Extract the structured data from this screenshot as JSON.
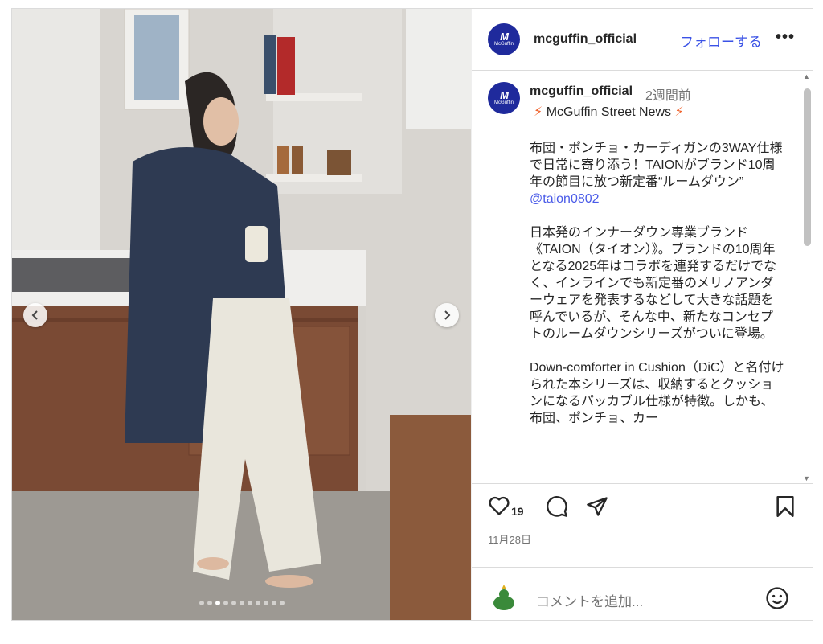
{
  "header": {
    "username": "mcguffin_official",
    "follow_label": "フォローする",
    "more_label": "•••"
  },
  "avatar": {
    "mark": "M",
    "word": "McGuffin"
  },
  "post": {
    "username": "mcguffin_official",
    "time_ago": "2週間前",
    "news_label": "McGuffin Street News",
    "caption_p1": "布団・ポンチョ・カーディガンの3WAY仕様で日常に寄り添う！TAIONがブランド10周年の節目に放つ新定番“ルームダウン”",
    "mention": "@taion0802",
    "caption_p2": "日本発のインナーダウン専業ブランド《TAION（タイオン）》。ブランドの10周年となる2025年はコラボを連発するだけでなく、インラインでも新定番のメリノアンダーウェアを発表するなどして大きな話題を呼んでいるが、そんな中、新たなコンセプトのルームダウンシリーズがついに登場。",
    "caption_p3": "Down-comforter in Cushion（DiC）と名付けられた本シリーズは、収納するとクッションになるパッカブル仕様が特徴。しかも、布団、ポンチョ、カー"
  },
  "actions": {
    "like_count": "19",
    "date": "11月28日"
  },
  "comment": {
    "placeholder": "コメントを追加..."
  },
  "carousel": {
    "slide_count": 11,
    "active_index": 2
  },
  "icons": [
    "heart-icon",
    "comment-icon",
    "share-icon",
    "bookmark-icon",
    "emoji-icon",
    "chevron-left-icon",
    "chevron-right-icon",
    "more-icon",
    "bolt-icon"
  ],
  "colors": {
    "brand": "#1f2a9c",
    "link": "#3a52e6",
    "bolt": "#f0642e"
  }
}
